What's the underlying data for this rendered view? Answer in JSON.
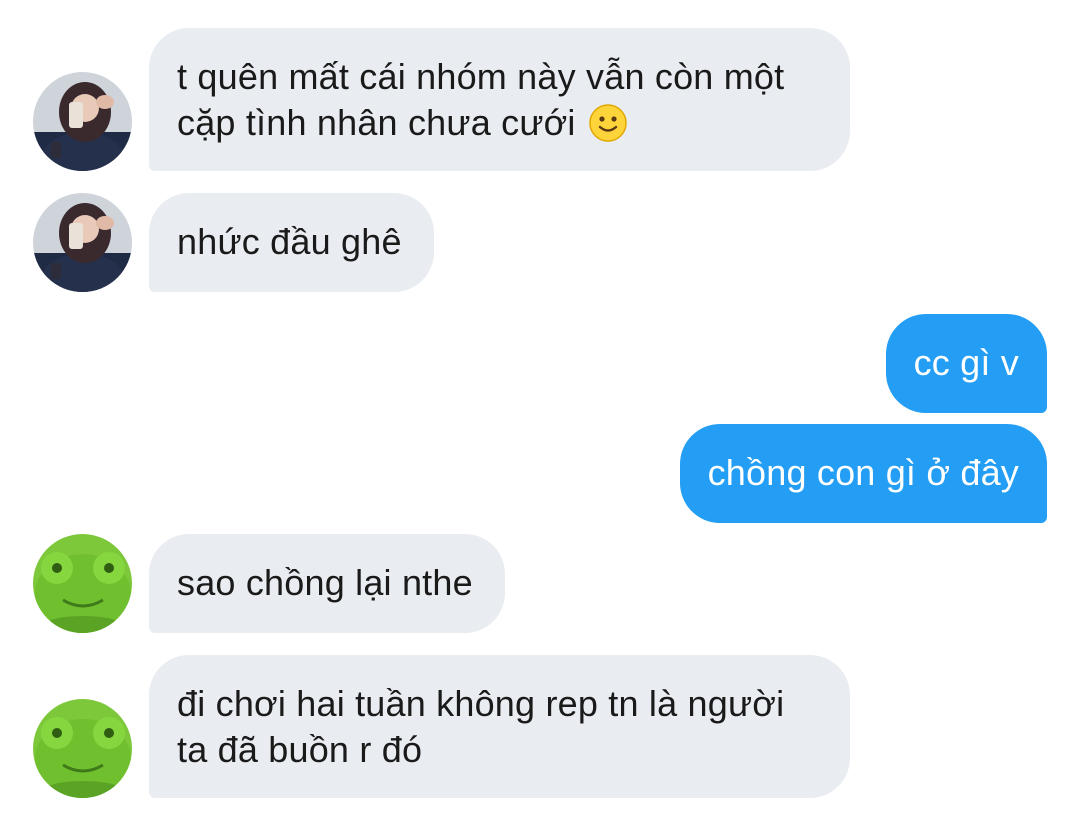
{
  "messages": [
    {
      "sender": "girl",
      "text": "t quên mất cái nhóm này vẫn còn một\ncặp tình nhân chưa cưới ",
      "emoji": "slightly-smiling-face-icon"
    },
    {
      "sender": "girl",
      "text": "nhức đầu ghê"
    },
    {
      "sender": "me",
      "text": "cc gì v"
    },
    {
      "sender": "me",
      "text": "chồng con gì ở đây"
    },
    {
      "sender": "frog",
      "text": "sao chồng lại nthe"
    },
    {
      "sender": "frog",
      "text": "đi chơi hai tuần không rep tn là người\nta đã buồn r đó"
    }
  ],
  "colors": {
    "incoming_bubble": "#e9ecf0",
    "outgoing_bubble": "#239ef4",
    "incoming_text": "#1a1a1a",
    "outgoing_text": "#ffffff"
  },
  "avatars": {
    "girl": "girl-photo-avatar",
    "frog": "green-frog-plush-avatar"
  }
}
